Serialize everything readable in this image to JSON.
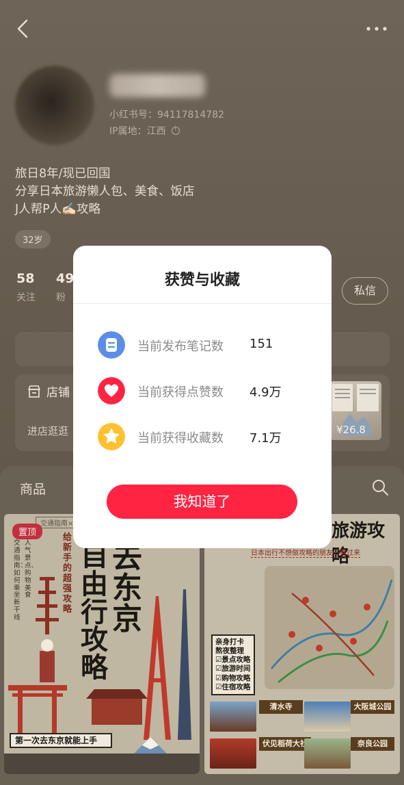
{
  "profile": {
    "id_label": "小红书号：94117814782",
    "ip_label": "IP属地：江西",
    "bio_lines": [
      "旅日8年/现已回国",
      "分享日本旅游懒人包、美食、饭店",
      "J人帮P人✍🏻攻略"
    ],
    "age_tag": "32岁",
    "stats": [
      {
        "value": "58",
        "label": "关注"
      },
      {
        "value": "49",
        "label": "粉"
      }
    ],
    "dm_button": "私信"
  },
  "store": {
    "label": "店铺",
    "enter_label": "进店逛逛",
    "thumb_price": "¥26.8"
  },
  "products": {
    "tab_label": "商品",
    "left_tile": {
      "pin_badge": "置顶",
      "strip_text": "交通指南×打",
      "big_text_1": "去东京",
      "big_text_2": "自由行攻略",
      "small_vertical": "给新手的超强攻略",
      "side_col_1": "交通指南：如何乘坐新干线",
      "side_col_2": "人气景点、购物美食",
      "bottom_bar": "第一次去东京就能上手"
    },
    "right_tile": {
      "title": "旅游攻略",
      "subtitle": "日本出行不想做攻略的朋友们看过来",
      "checklist": [
        "亲身打卡",
        "熬夜整理",
        "☑景点攻略",
        "☑旅游时间",
        "☑购物攻略",
        "☑住宿攻略"
      ],
      "spots": [
        "清水寺",
        "大阪城公园",
        "伏见稻荷大社",
        "奈良公园"
      ]
    }
  },
  "modal": {
    "title": "获赞与收藏",
    "rows": [
      {
        "label": "当前发布笔记数",
        "value": "151",
        "icon": "note-icon",
        "color": "#5b8ee6"
      },
      {
        "label": "当前获得点赞数",
        "value": "4.9万",
        "icon": "heart-icon",
        "color": "#ff2442"
      },
      {
        "label": "当前获得收藏数",
        "value": "7.1万",
        "icon": "star-icon",
        "color": "#ffc02e"
      }
    ],
    "confirm_button": "我知道了"
  }
}
